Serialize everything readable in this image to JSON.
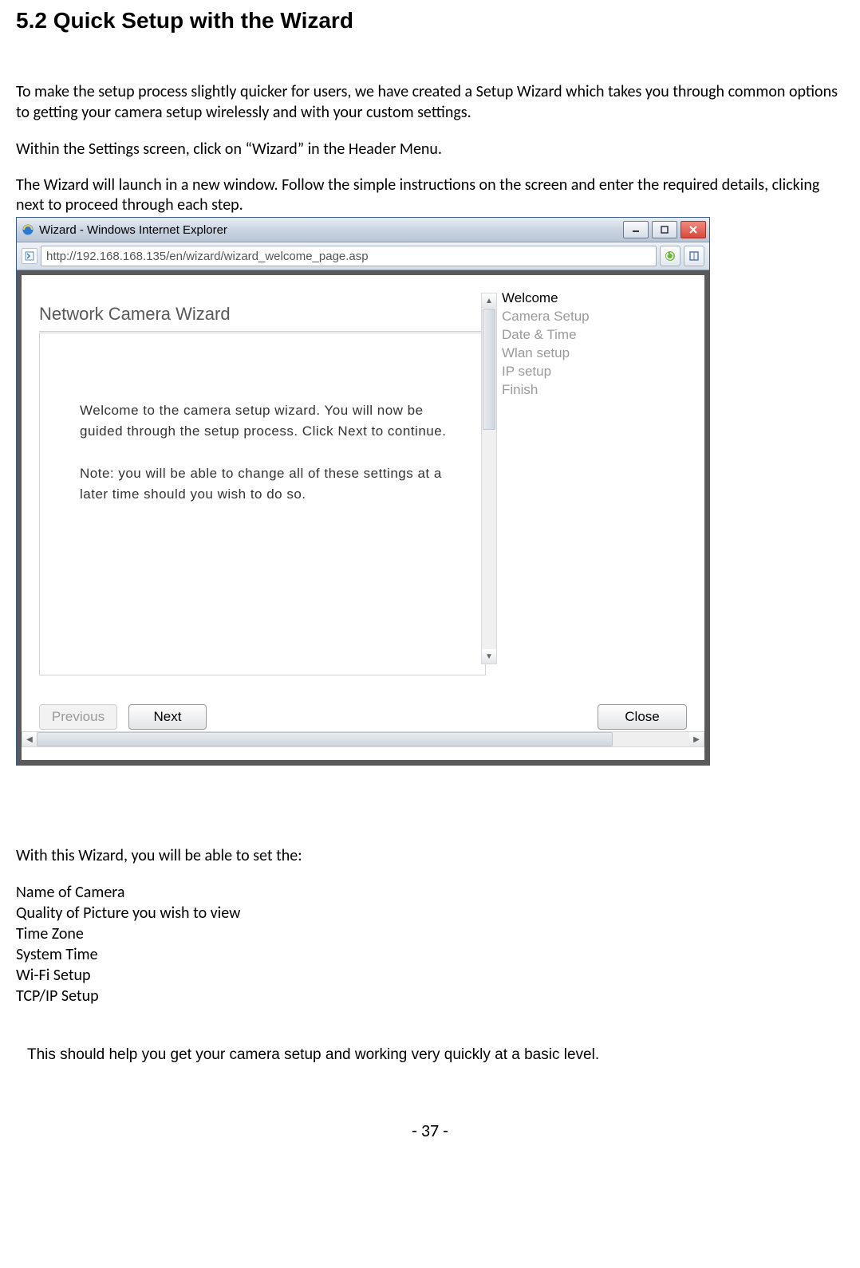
{
  "heading": "5.2 Quick Setup with the Wizard",
  "para1": "To make the setup process slightly quicker for users, we have created a Setup Wizard which takes you through common options to getting your camera setup wirelessly and with your custom settings.",
  "para2": "Within the Settings screen, click on “Wizard” in the Header Menu.",
  "para3": "The Wizard will launch in a new window. Follow the simple instructions on the screen and enter the required details, clicking next to proceed through each step.",
  "browser": {
    "title": "Wizard - Windows Internet Explorer",
    "url": "http://192.168.168.135/en/wizard/wizard_welcome_page.asp"
  },
  "wizard": {
    "header": "Network Camera Wizard",
    "msg1": "Welcome to the camera setup wizard. You will now be guided through the setup process. Click Next to continue.",
    "msg2": "Note: you will be able to change all of these settings at a later time should you wish to do so.",
    "steps": [
      "Welcome",
      "Camera Setup",
      "Date & Time",
      "Wlan setup",
      "IP setup",
      "Finish"
    ],
    "active_step_index": 0,
    "buttons": {
      "previous": "Previous",
      "next": "Next",
      "close": "Close"
    }
  },
  "after1": "With this Wizard, you will be able to set the:",
  "set_list": [
    "Name    of Camera",
    "Quality of Picture you wish to view",
    "Time Zone",
    "System Time",
    "Wi-Fi Setup",
    "TCP/IP Setup"
  ],
  "closing": "This should help you get your camera setup and working very quickly at a basic level.",
  "page_number": "- 37 -"
}
